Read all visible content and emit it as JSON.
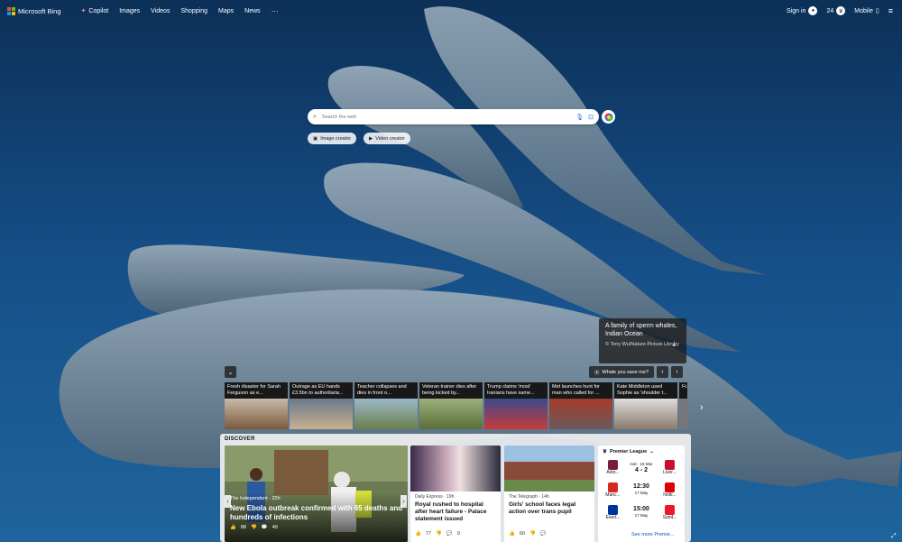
{
  "brand": {
    "name": "Microsoft Bing"
  },
  "nav": [
    "Copilot",
    "Images",
    "Videos",
    "Shopping",
    "Maps",
    "News"
  ],
  "header_right": {
    "sign_in": "Sign in",
    "reward_points": "24",
    "mobile": "Mobile"
  },
  "search": {
    "placeholder": "Search the web"
  },
  "chips": {
    "image_creator": "Image creator",
    "video_creator": "Video creator"
  },
  "image_info": {
    "title": "A family of sperm whales, Indian Ocean",
    "credit": "© Tony Wu/Nature Picture Library"
  },
  "quiz": {
    "label": "Whale you save me?"
  },
  "news_strip": [
    "Fresh disaster for Sarah Ferguson as e...",
    "Outrage as EU hands £3.5bn to authoritaria...",
    "Teacher collapses and dies in front o...",
    "Veteran trainer dies after being kicked by...",
    "Trump claims 'most' Iranians have same...",
    "Met launches hunt for man who called for ...",
    "Kate Middleton used Sophie as 'shoulder t...",
    "Fr..."
  ],
  "discover": {
    "title": "DISCOVER",
    "hero": {
      "source": "The Independent · 22h",
      "headline": "New Ebola outbreak confirmed with 65 deaths and hundreds of infections",
      "likes": "88",
      "comments": "49"
    },
    "cards": [
      {
        "source": "Daily Express · 19h",
        "headline": "Royal rushed to hospital after heart failure - Palace statement issued",
        "likes": "77",
        "comments": "9"
      },
      {
        "source": "The Telegraph · 14h",
        "headline": "Girls' school faces legal action over trans pupil",
        "likes": "60",
        "comments": ""
      }
    ],
    "premier_league": {
      "title": "Premier League",
      "matches": [
        {
          "home": "Asto...",
          "status": "inal · 15 Mar",
          "score": "4 - 2",
          "away": "Liver..."
        },
        {
          "home": "Manc...",
          "status": "17 May",
          "score": "12:30",
          "away": "Notti..."
        },
        {
          "home": "Evert...",
          "status": "17 May",
          "score": "15:00",
          "away": "Sund..."
        }
      ],
      "more": "See more Premie..."
    }
  },
  "colors": {
    "ms_red": "#f25022",
    "ms_green": "#7fba00",
    "ms_blue": "#00a4ef",
    "ms_yellow": "#ffb900",
    "ocean_top": "#0d3560",
    "ocean_bottom": "#1d5f96"
  }
}
